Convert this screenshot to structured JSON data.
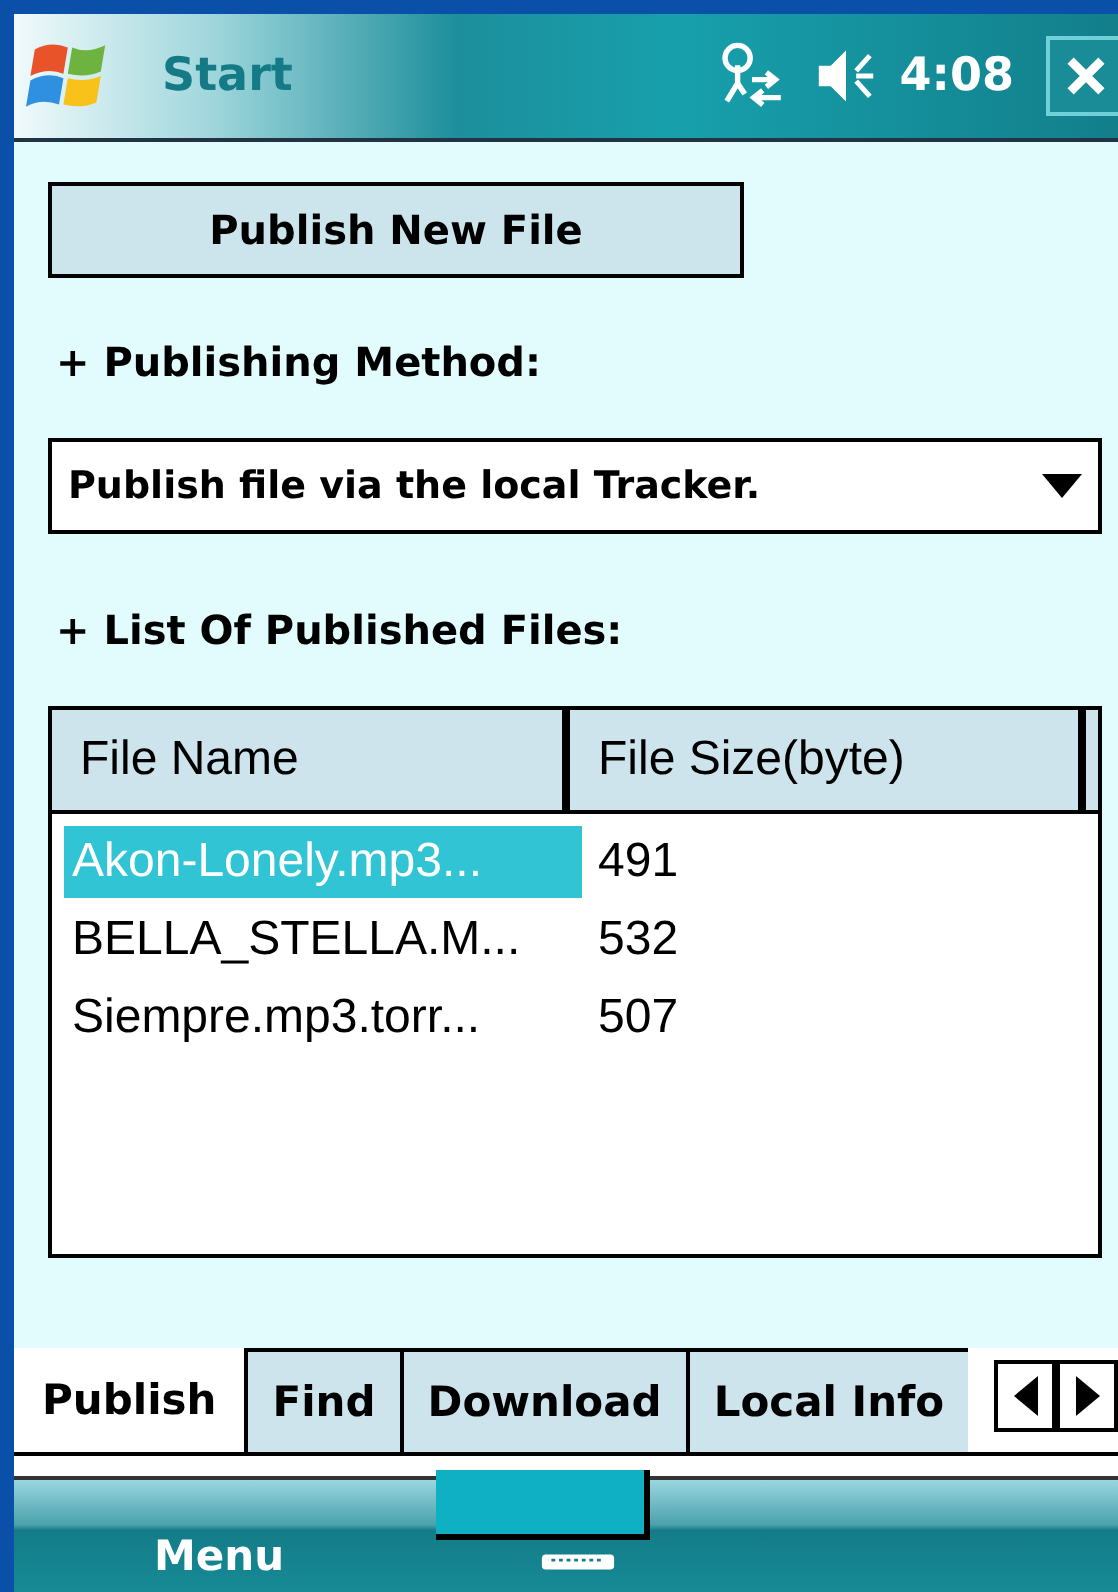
{
  "title_bar": {
    "title": "Start",
    "time": "4:08"
  },
  "publish_button": "Publish New File",
  "method_heading": "+ Publishing Method:",
  "method_dropdown": {
    "value": "Publish file via the local Tracker."
  },
  "files_heading": "+ List Of Published Files:",
  "table": {
    "columns": [
      "File Name",
      "File Size(byte)"
    ],
    "rows": [
      {
        "cells": [
          "Akon-Lonely.mp3...",
          "491"
        ],
        "selected": true
      },
      {
        "cells": [
          "BELLA_STELLA.M...",
          "532"
        ],
        "selected": false
      },
      {
        "cells": [
          "Siempre.mp3.torr...",
          "507"
        ],
        "selected": false
      }
    ]
  },
  "tabs": [
    {
      "label": "Publish",
      "selected": true
    },
    {
      "label": "Find",
      "selected": false
    },
    {
      "label": "Download",
      "selected": false
    },
    {
      "label": "Local Info",
      "selected": false
    }
  ],
  "soft_keys": {
    "left": "Menu"
  }
}
